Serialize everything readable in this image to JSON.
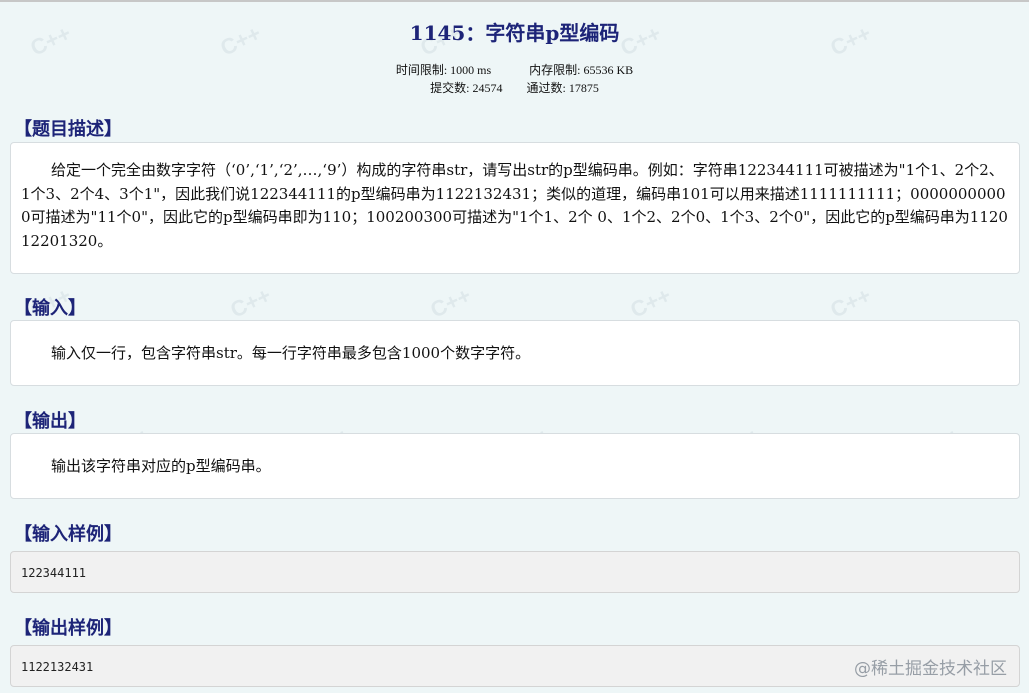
{
  "problem": {
    "title": "1145：字符串p型编码",
    "time_limit": "时间限制: 1000 ms",
    "memory_limit": "内存限制: 65536 KB",
    "submissions": "提交数: 24574",
    "accepted": "通过数: 17875"
  },
  "sections": {
    "description_title": "【题目描述】",
    "description_text": "给定一个完全由数字字符（‘0’,‘1’,‘2’,…,‘9’）构成的字符串str，请写出str的p型编码串。例如：字符串122344111可被描述为\"1个1、2个2、1个3、2个4、3个1\"，因此我们说122344111的p型编码串为1122132431；类似的道理，编码串101可以用来描述1111111111；00000000000可描述为\"11个0\"，因此它的p型编码串即为110；100200300可描述为\"1个1、2个 0、1个2、2个0、1个3、2个0\"，因此它的p型编码串为112012201320。",
    "input_title": "【输入】",
    "input_text": "输入仅一行，包含字符串str。每一行字符串最多包含1000个数字字符。",
    "output_title": "【输出】",
    "output_text": "输出该字符串对应的p型编码串。",
    "sample_input_title": "【输入样例】",
    "sample_input_value": "122344111",
    "sample_output_title": "【输出样例】",
    "sample_output_value": "1122132431"
  },
  "branding": {
    "watermark": "@稀土掘金技术社区"
  },
  "colors": {
    "heading": "#1d2478",
    "background": "#eef6f7",
    "panel": "#ffffff",
    "sample_panel": "#f1f1f1"
  }
}
